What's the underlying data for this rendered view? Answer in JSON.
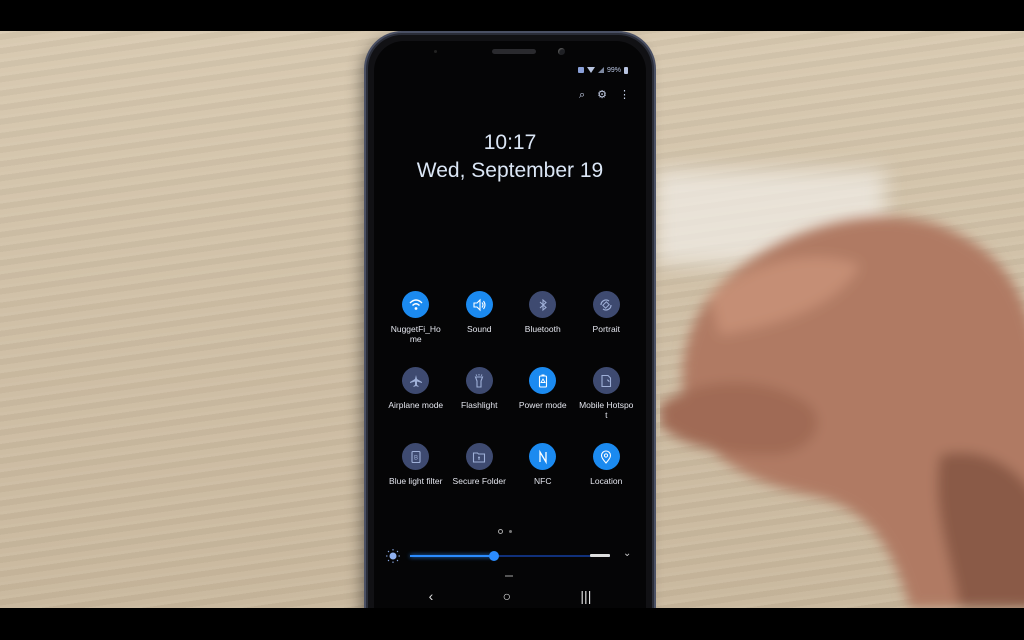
{
  "status_bar": {
    "battery": "99%",
    "icons": [
      "nfc-icon",
      "wifi-icon",
      "signal-icon",
      "battery-icon"
    ]
  },
  "top_actions": [
    {
      "name": "search-icon",
      "glyph": "⌕"
    },
    {
      "name": "gear-icon",
      "glyph": "⚙"
    },
    {
      "name": "more-icon",
      "glyph": "⋮"
    }
  ],
  "clock": {
    "time": "10:17",
    "date": "Wed, September 19"
  },
  "quick_tiles": [
    {
      "label": "NuggetFi_Home",
      "icon": "wifi-icon",
      "on": true
    },
    {
      "label": "Sound",
      "icon": "speaker-icon",
      "on": true
    },
    {
      "label": "Bluetooth",
      "icon": "bluetooth-icon",
      "on": false
    },
    {
      "label": "Portrait",
      "icon": "rotate-icon",
      "on": false
    },
    {
      "label": "Airplane mode",
      "icon": "airplane-icon",
      "on": false
    },
    {
      "label": "Flashlight",
      "icon": "flashlight-icon",
      "on": false
    },
    {
      "label": "Power mode",
      "icon": "battery-mode-icon",
      "on": true
    },
    {
      "label": "Mobile Hotspot",
      "icon": "hotspot-icon",
      "on": false
    },
    {
      "label": "Blue light filter",
      "icon": "blue-light-icon",
      "on": false
    },
    {
      "label": "Secure Folder",
      "icon": "secure-folder-icon",
      "on": false
    },
    {
      "label": "NFC",
      "icon": "nfc-icon",
      "on": true
    },
    {
      "label": "Location",
      "icon": "location-icon",
      "on": true
    }
  ],
  "page_indicator": {
    "current": 1,
    "total": 2
  },
  "brightness": {
    "level_percent": 42
  },
  "nav_bar": {
    "back": "‹",
    "home": "○",
    "recents": "|||"
  },
  "colors": {
    "tile_on": "#1b8af0",
    "tile_off": "#3e4a70",
    "slider": "#2b8cff"
  }
}
